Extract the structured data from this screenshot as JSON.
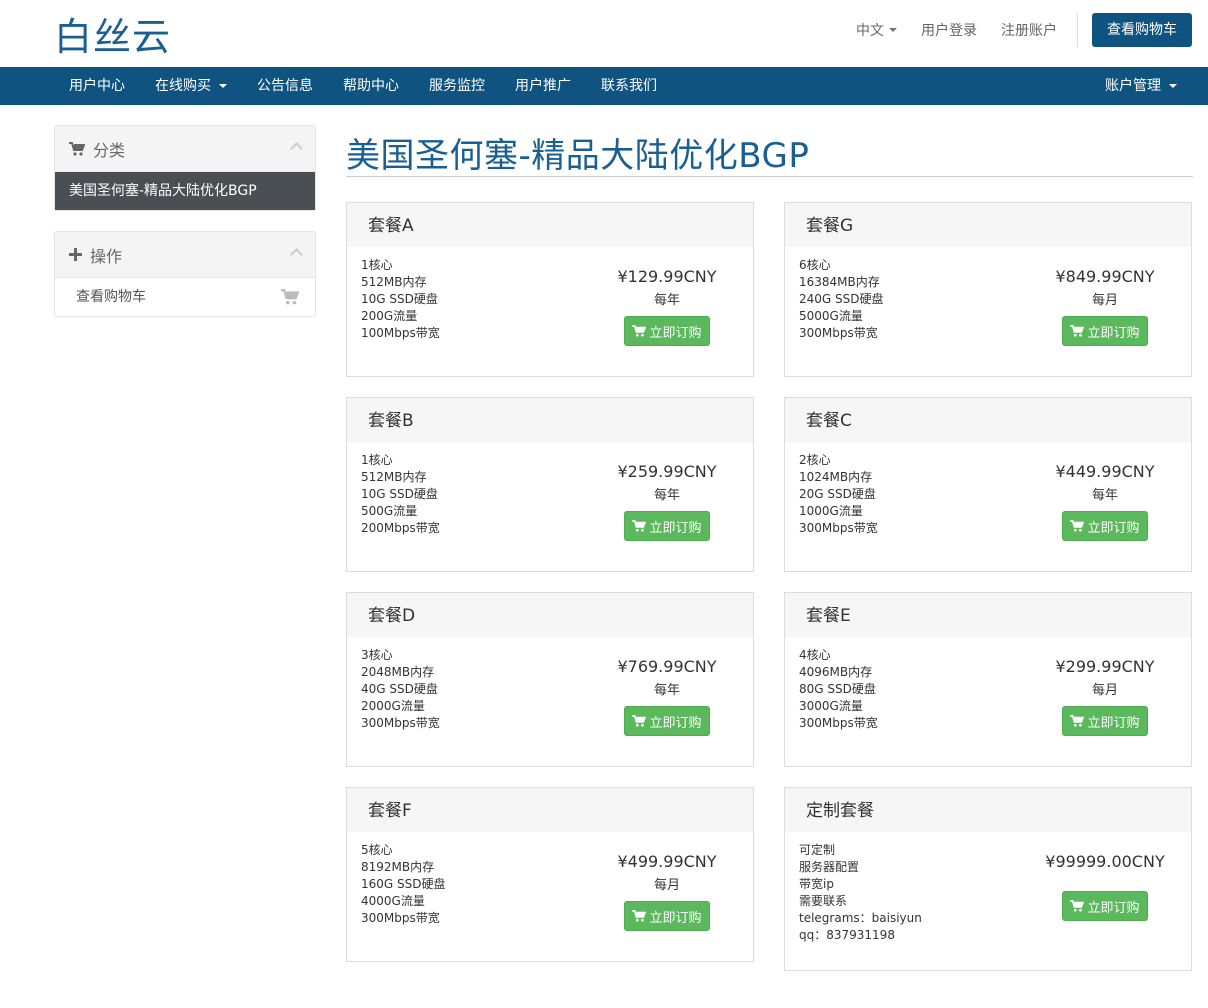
{
  "header": {
    "logo": "白丝云",
    "lang_label": "中文",
    "login_label": "用户登录",
    "register_label": "注册账户",
    "cart_button": "查看购物车"
  },
  "nav": {
    "items": [
      "用户中心",
      "在线购买",
      "公告信息",
      "帮助中心",
      "服务监控",
      "用户推广",
      "联系我们"
    ],
    "account": "账户管理"
  },
  "sidebar": {
    "categories_title": "分类",
    "category_item": "美国圣何塞-精品大陆优化BGP",
    "actions_title": "操作",
    "view_cart": "查看购物车"
  },
  "page_title": "美国圣何塞-精品大陆优化BGP",
  "order_label": "立即订购",
  "products": [
    {
      "name": "套餐A",
      "features": [
        "1核心",
        "512MB内存",
        "10G SSD硬盘",
        "200G流量",
        "100Mbps带宽"
      ],
      "price": "¥129.99CNY",
      "cycle": "每年"
    },
    {
      "name": "套餐G",
      "features": [
        "6核心",
        "16384MB内存",
        "240G SSD硬盘",
        "5000G流量",
        "300Mbps带宽"
      ],
      "price": "¥849.99CNY",
      "cycle": "每月"
    },
    {
      "name": "套餐B",
      "features": [
        "1核心",
        "512MB内存",
        "10G SSD硬盘",
        "500G流量",
        "200Mbps带宽"
      ],
      "price": "¥259.99CNY",
      "cycle": "每年"
    },
    {
      "name": "套餐C",
      "features": [
        "2核心",
        "1024MB内存",
        "20G SSD硬盘",
        "1000G流量",
        "300Mbps带宽"
      ],
      "price": "¥449.99CNY",
      "cycle": "每年"
    },
    {
      "name": "套餐D",
      "features": [
        "3核心",
        "2048MB内存",
        "40G SSD硬盘",
        "2000G流量",
        "300Mbps带宽"
      ],
      "price": "¥769.99CNY",
      "cycle": "每年"
    },
    {
      "name": "套餐E",
      "features": [
        "4核心",
        "4096MB内存",
        "80G SSD硬盘",
        "3000G流量",
        "300Mbps带宽"
      ],
      "price": "¥299.99CNY",
      "cycle": "每月"
    },
    {
      "name": "套餐F",
      "features": [
        "5核心",
        "8192MB内存",
        "160G SSD硬盘",
        "4000G流量",
        "300Mbps带宽"
      ],
      "price": "¥499.99CNY",
      "cycle": "每月"
    },
    {
      "name": "定制套餐",
      "features": [
        "可定制",
        "服务器配置",
        "带宽ip",
        "需要联系",
        "telegrams：baisiyun",
        "qq：837931198"
      ],
      "price": "¥99999.00CNY",
      "cycle": ""
    }
  ]
}
